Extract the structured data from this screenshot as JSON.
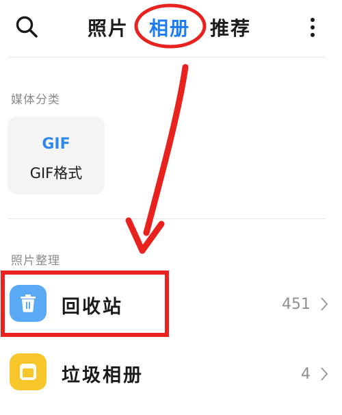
{
  "header": {
    "tabs": [
      "照片",
      "相册",
      "推荐"
    ],
    "active_tab": "相册"
  },
  "media_section": {
    "title": "媒体分类",
    "gif_card": {
      "badge": "GIF",
      "label": "GIF格式"
    }
  },
  "organize_section": {
    "title": "照片整理",
    "items": [
      {
        "label": "回收站",
        "count": "451",
        "icon": "trash-icon"
      },
      {
        "label": "垃圾相册",
        "count": "4",
        "icon": "junk-album-icon"
      }
    ]
  },
  "colors": {
    "accent": "#1e7cf2",
    "annotation_red": "#e8231f",
    "trash_icon_bg": "#5aa9f4",
    "junk_icon_bg": "#f6c62b"
  }
}
